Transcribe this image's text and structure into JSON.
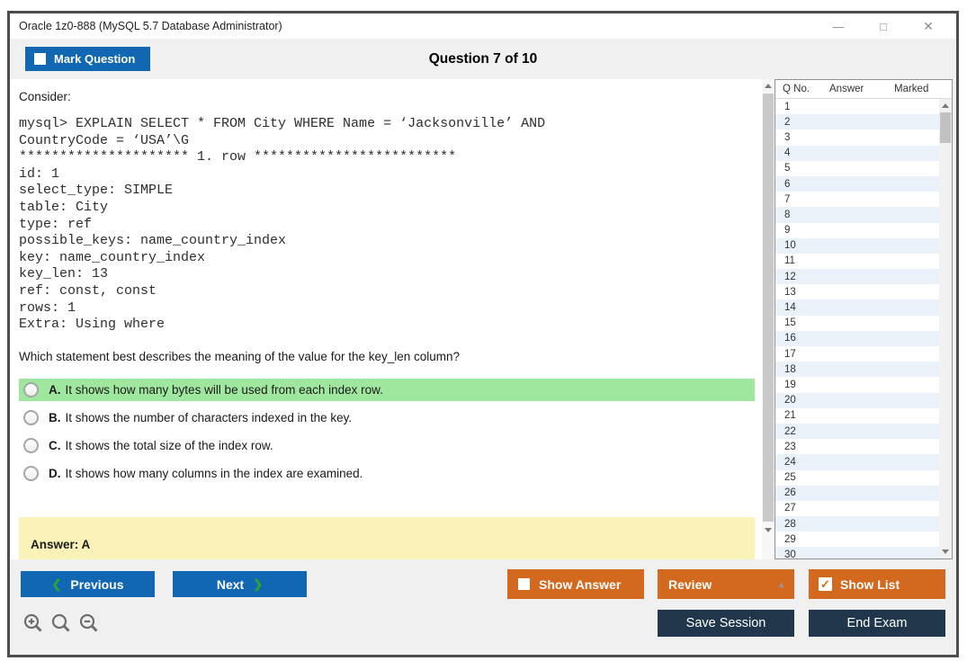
{
  "window": {
    "title": "Oracle 1z0-888 (MySQL 5.7 Database Administrator)",
    "controls": {
      "minimize_glyph": "—",
      "maximize_glyph": "□",
      "close_glyph": "✕"
    }
  },
  "header": {
    "mark_question_label": "Mark Question",
    "question_counter": "Question 7 of 10"
  },
  "question": {
    "intro": "Consider:",
    "code_lines": [
      "mysql> EXPLAIN SELECT * FROM City WHERE Name = ‘Jacksonville’ AND",
      "CountryCode = ‘USA’\\G",
      "********************* 1. row *************************",
      "id: 1",
      "select_type: SIMPLE",
      "table: City",
      "type: ref",
      "possible_keys: name_country_index",
      "key: name_country_index",
      "key_len: 13",
      "ref: const, const",
      "rows: 1",
      "Extra: Using where"
    ],
    "prompt": "Which statement best describes the meaning of the value for the key_len column?",
    "options": [
      {
        "letter": "A.",
        "text": "It shows how many bytes will be used from each index row.",
        "highlighted": true
      },
      {
        "letter": "B.",
        "text": "It shows the number of characters indexed in the key.",
        "highlighted": false
      },
      {
        "letter": "C.",
        "text": "It shows the total size of the index row.",
        "highlighted": false
      },
      {
        "letter": "D.",
        "text": "It shows how many columns in the index are examined.",
        "highlighted": false
      }
    ],
    "answer_label": "Answer: A"
  },
  "question_list": {
    "columns": [
      "Q No.",
      "Answer",
      "Marked"
    ],
    "rows": [
      "1",
      "2",
      "3",
      "4",
      "5",
      "6",
      "7",
      "8",
      "9",
      "10",
      "11",
      "12",
      "13",
      "14",
      "15",
      "16",
      "17",
      "18",
      "19",
      "20",
      "21",
      "22",
      "23",
      "24",
      "25",
      "26",
      "27",
      "28",
      "29",
      "30"
    ]
  },
  "footer": {
    "previous_label": "Previous",
    "next_label": "Next",
    "prev_chevron": "❮",
    "next_chevron": "❯",
    "show_answer_label": "Show Answer",
    "review_label": "Review",
    "review_arrow": "▲",
    "show_list_label": "Show List",
    "show_list_check": "✓",
    "save_session_label": "Save Session",
    "end_exam_label": "End Exam"
  },
  "colors": {
    "accent_blue": "#1267b2",
    "accent_orange": "#d2691e",
    "accent_navy": "#20374b",
    "highlight_green": "#9fe79f",
    "answer_yellow": "#faf2b8",
    "row_alt_blue": "#eaf1f8",
    "chevron_green": "#2fa52f"
  }
}
